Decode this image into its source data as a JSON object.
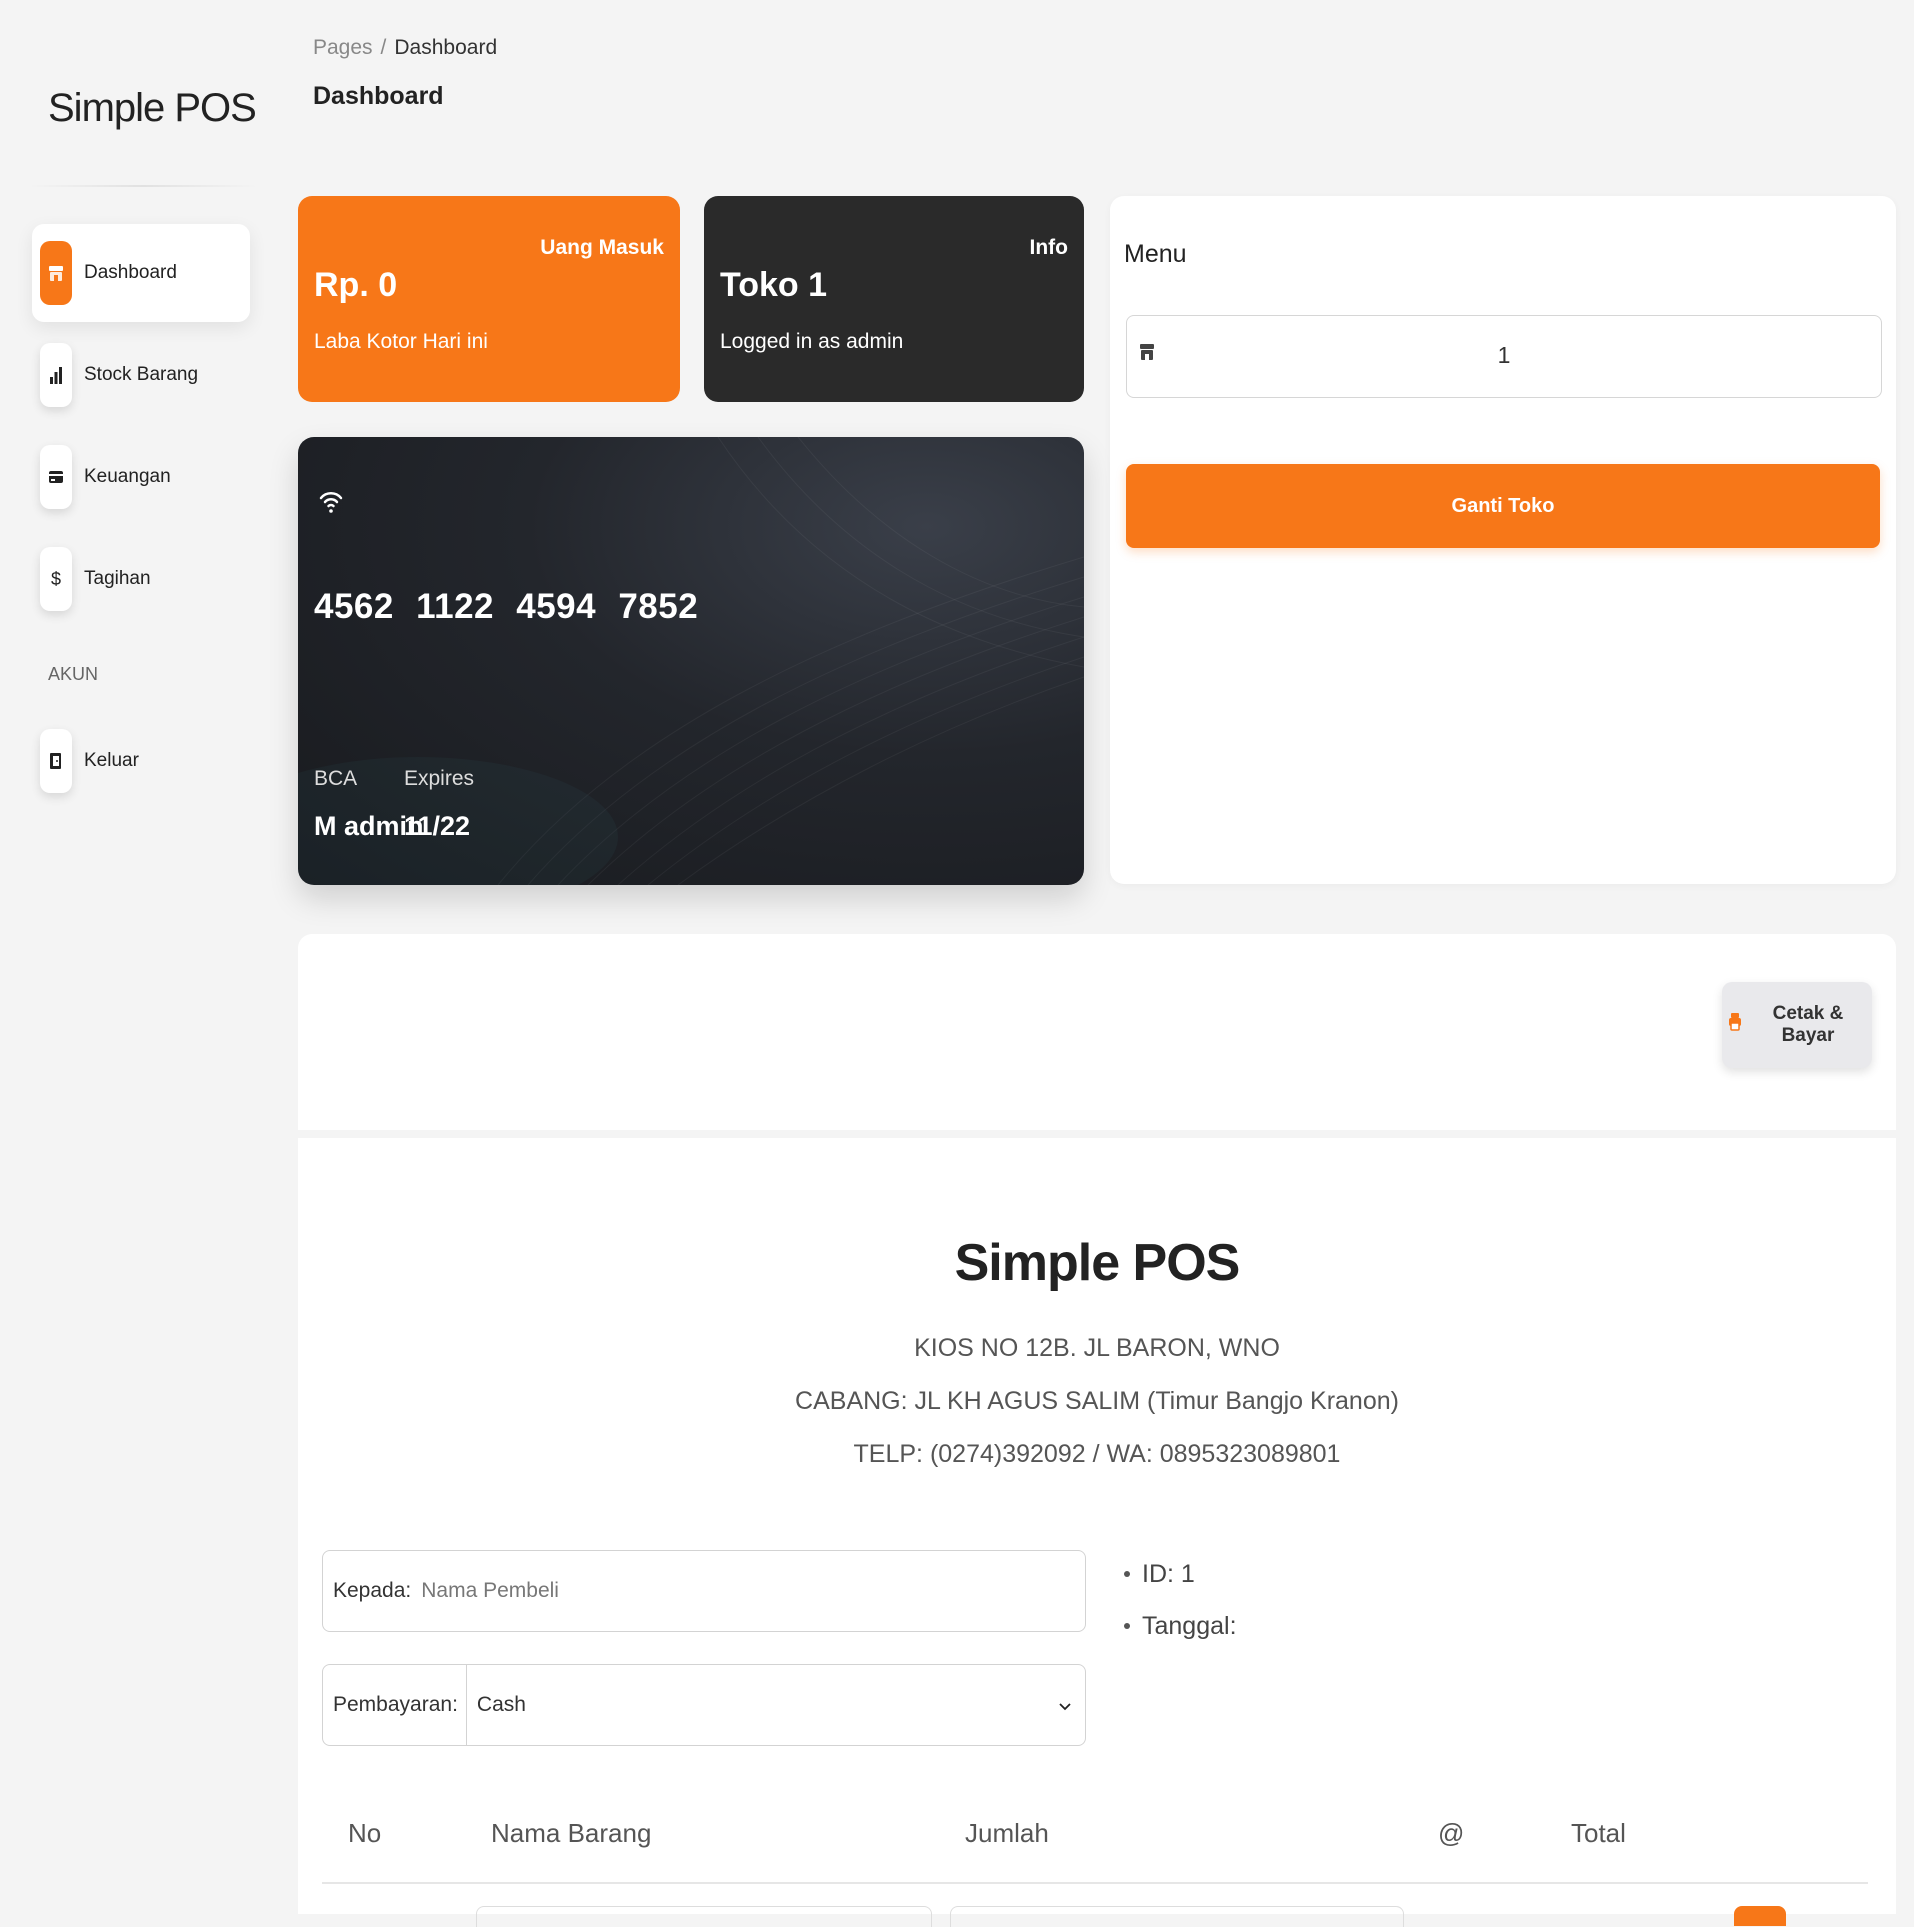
{
  "sidebar": {
    "brand": "Simple POS",
    "items": [
      {
        "label": "Dashboard",
        "icon": "store-icon",
        "active": true
      },
      {
        "label": "Stock Barang",
        "icon": "chart-icon",
        "active": false
      },
      {
        "label": "Keuangan",
        "icon": "credit-card-icon",
        "active": false
      },
      {
        "label": "Tagihan",
        "icon": "dollar-icon",
        "active": false
      }
    ],
    "section_label": "AKUN",
    "account_items": [
      {
        "label": "Keluar",
        "icon": "logout-icon"
      }
    ]
  },
  "header": {
    "breadcrumb": [
      "Pages",
      "Dashboard"
    ],
    "title": "Dashboard"
  },
  "stats": {
    "income": {
      "tag": "Uang Masuk",
      "value": "Rp. 0",
      "caption": "Laba Kotor Hari ini"
    },
    "info": {
      "tag": "Info",
      "value": "Toko 1",
      "caption": "Logged in as admin"
    }
  },
  "credit_card": {
    "number": "4562 1122 4594 7852",
    "bank_label": "BCA",
    "holder": "M admin",
    "expires_label": "Expires",
    "expires_value": "11/22"
  },
  "menu": {
    "title": "Menu",
    "store_value": "1",
    "button_label": "Ganti Toko"
  },
  "invoice": {
    "print_button": "Cetak & Bayar",
    "title": "Simple POS",
    "address_lines": [
      "KIOS NO 12B. JL BARON, WNO",
      "CABANG: JL KH AGUS SALIM (Timur Bangjo Kranon)",
      "TELP: (0274)392092 / WA: 0895323089801"
    ],
    "buyer_label": "Kepada:",
    "buyer_placeholder": "Nama Pembeli",
    "payment_label": "Pembayaran:",
    "payment_value": "Cash",
    "meta": [
      "ID: 1",
      "Tanggal:"
    ],
    "columns": [
      "No",
      "Nama Barang",
      "Jumlah",
      "@",
      "Total"
    ]
  },
  "colors": {
    "accent": "#f77718",
    "dark_card": "#2a2a2a",
    "background": "#f4f4f4"
  }
}
